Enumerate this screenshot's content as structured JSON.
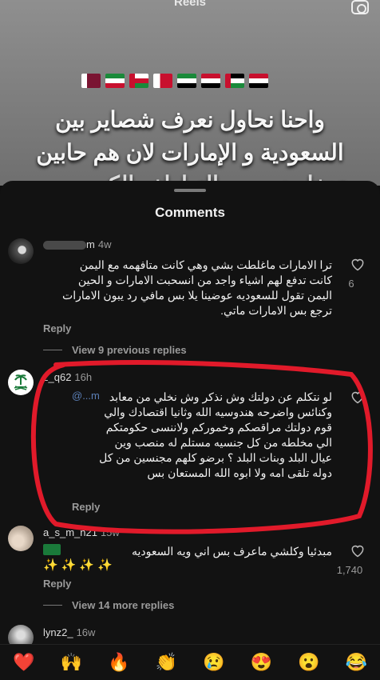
{
  "reel": {
    "title": "Reels",
    "overlay_lines": [
      "واحنا نحاول نعرف شصاير بين",
      "السعودية و الإمارات لان هم حابين",
      "تدخلون سبب التعاطف الكبير مع..."
    ]
  },
  "sheet": {
    "title": "Comments"
  },
  "comments": [
    {
      "username": "m",
      "age": "4w",
      "text": "ترا الامارات ماغلطت بشي وهي كانت متافهمه مع اليمن كانت تدفع لهم اشياء واجد من انسحبت الامارات و الحين اليمن تقول للسعوديه عوضينا يلا بس مافي رد يبون الامارات ترجع بس الامارات ماتي.",
      "reply_label": "Reply",
      "like_count": "6"
    },
    {
      "view_replies": "View 9 previous replies"
    },
    {
      "username": "z_q62",
      "age": "16h",
      "mention": "@...m",
      "text": "لو نتكلم عن دولتك وش نذكر وش نخلي من معابد وكنائس واضرحه هندوسيه الله وثانيا اقتصادك والي قوم دولتك مراقصكم وخموركم ولاننسى حكومتكم الي مخلطه من كل جنسيه مستلم له منصب وين عيال البلد وبنات البلد ؟ برضو كلهم مجنسين من كل دوله تلقى امه ولا ابوه الله المستعان بس",
      "reply_label": "Reply"
    },
    {
      "username": "a_s_m_n21",
      "age": "15w",
      "line1": "مبدئيا وكلشي ماعرف بس اني ويه السعوديه",
      "line2": "✨✨✨✨",
      "reply_label": "Reply",
      "like_count": "1,740"
    },
    {
      "view_replies": "View 14 more replies"
    },
    {
      "username": "lynz2_",
      "age": "16w"
    }
  ],
  "emoji_bar": [
    "❤️",
    "🙌",
    "🔥",
    "👏",
    "😢",
    "😍",
    "😮",
    "😂"
  ],
  "colors": {
    "annotation": "#e11a2a",
    "background": "#121212",
    "muted": "#9a9a9a"
  }
}
